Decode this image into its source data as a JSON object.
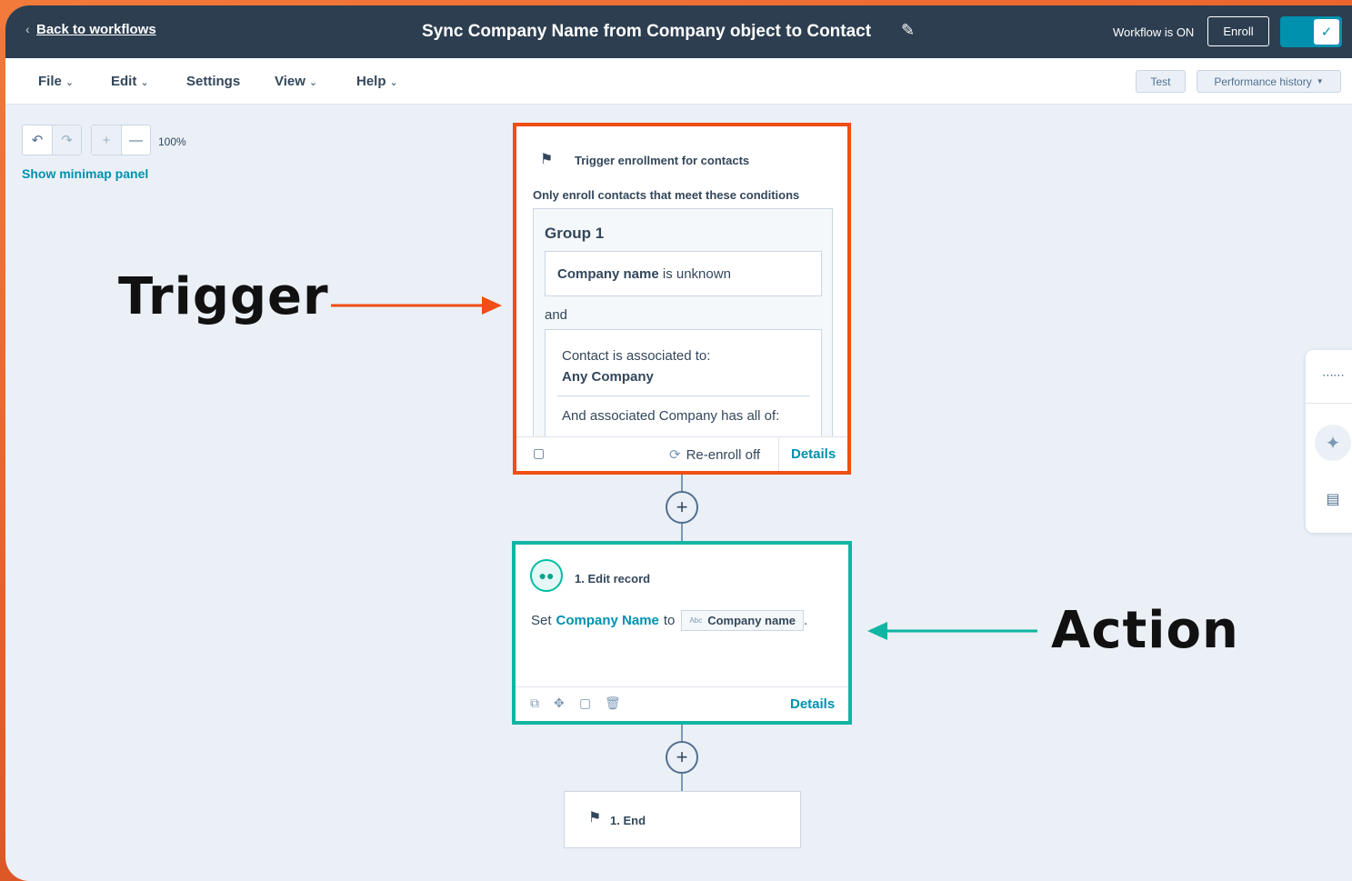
{
  "header": {
    "back_label": "Back to workflows",
    "title": "Sync Company Name from Company object to Contact",
    "status": "Workflow is ON",
    "enroll_label": "Enroll",
    "toggle_on": true
  },
  "menu": {
    "items": [
      {
        "label": "File",
        "has_dropdown": true
      },
      {
        "label": "Edit",
        "has_dropdown": true
      },
      {
        "label": "Settings",
        "has_dropdown": false
      },
      {
        "label": "View",
        "has_dropdown": true
      },
      {
        "label": "Help",
        "has_dropdown": true
      }
    ],
    "test_label": "Test",
    "performance_label": "Performance history"
  },
  "canvas": {
    "zoom_level": "100%",
    "minimap_label": "Show minimap panel"
  },
  "annotations": {
    "trigger": "Trigger",
    "action": "Action",
    "trigger_color": "#f04e14",
    "action_color": "#10b5a3"
  },
  "trigger_card": {
    "title": "Trigger enrollment for contacts",
    "subtitle": "Only enroll contacts that meet these conditions",
    "group_title": "Group 1",
    "condition1_property": "Company name",
    "condition1_operator": "is unknown",
    "and_label": "and",
    "condition2_line1": "Contact is associated to:",
    "condition2_line2": "Any Company",
    "condition2_line3": "And associated Company has all of:",
    "reenroll_label": "Re-enroll off",
    "details_label": "Details"
  },
  "action_card": {
    "title": "1. Edit record",
    "set_label": "Set",
    "property": "Company Name",
    "to_label": "to",
    "token_type": "Abc",
    "token_label": "Company name",
    "period": ".",
    "details_label": "Details"
  },
  "end_card": {
    "label": "1. End"
  },
  "colors": {
    "header_bg": "#2d3e50",
    "accent": "#0091ae",
    "canvas_bg": "#eaf0f6"
  }
}
